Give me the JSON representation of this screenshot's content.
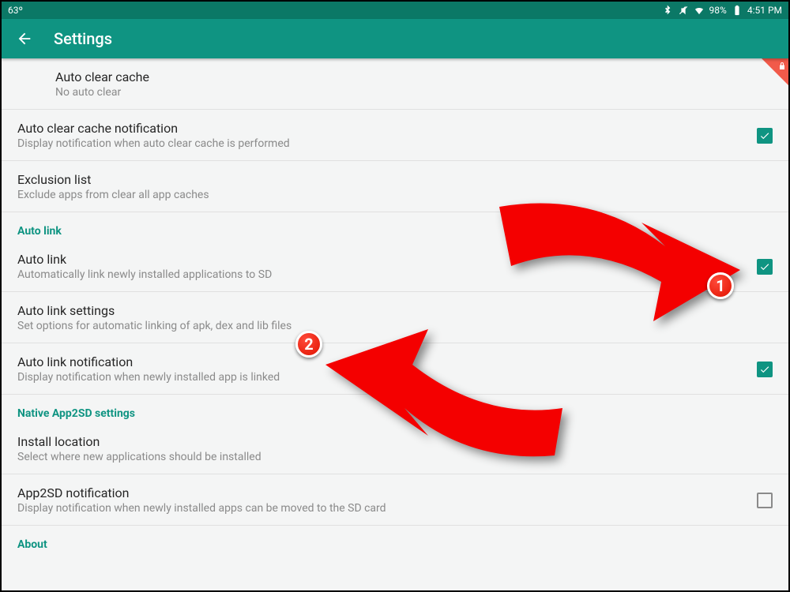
{
  "status": {
    "temp": "63º",
    "battery_pct": "98%",
    "time": "4:51 PM"
  },
  "appbar": {
    "title": "Settings"
  },
  "rows": {
    "auto_clear_cache": {
      "title": "Auto clear cache",
      "sub": "No auto clear"
    },
    "auto_clear_notif": {
      "title": "Auto clear cache notification",
      "sub": "Display notification when auto clear cache is performed"
    },
    "exclusion_list": {
      "title": "Exclusion list",
      "sub": "Exclude apps from clear all app caches"
    },
    "section_autolink": "Auto link",
    "auto_link": {
      "title": "Auto link",
      "sub": "Automatically link newly installed applications to SD"
    },
    "auto_link_settings": {
      "title": "Auto link settings",
      "sub": "Set options for automatic linking of apk, dex and lib files"
    },
    "auto_link_notif": {
      "title": "Auto link notification",
      "sub": "Display notification when newly installed app is linked"
    },
    "section_native": "Native App2SD settings",
    "install_location": {
      "title": "Install location",
      "sub": "Select where new applications should be installed"
    },
    "app2sd_notif": {
      "title": "App2SD notification",
      "sub": "Display notification when newly installed apps can be moved to the SD card"
    },
    "section_about": "About"
  },
  "checks": {
    "auto_clear_notif": true,
    "auto_link": true,
    "auto_link_notif": true,
    "app2sd_notif": false
  },
  "annotations": {
    "badge1": "1",
    "badge2": "2"
  }
}
